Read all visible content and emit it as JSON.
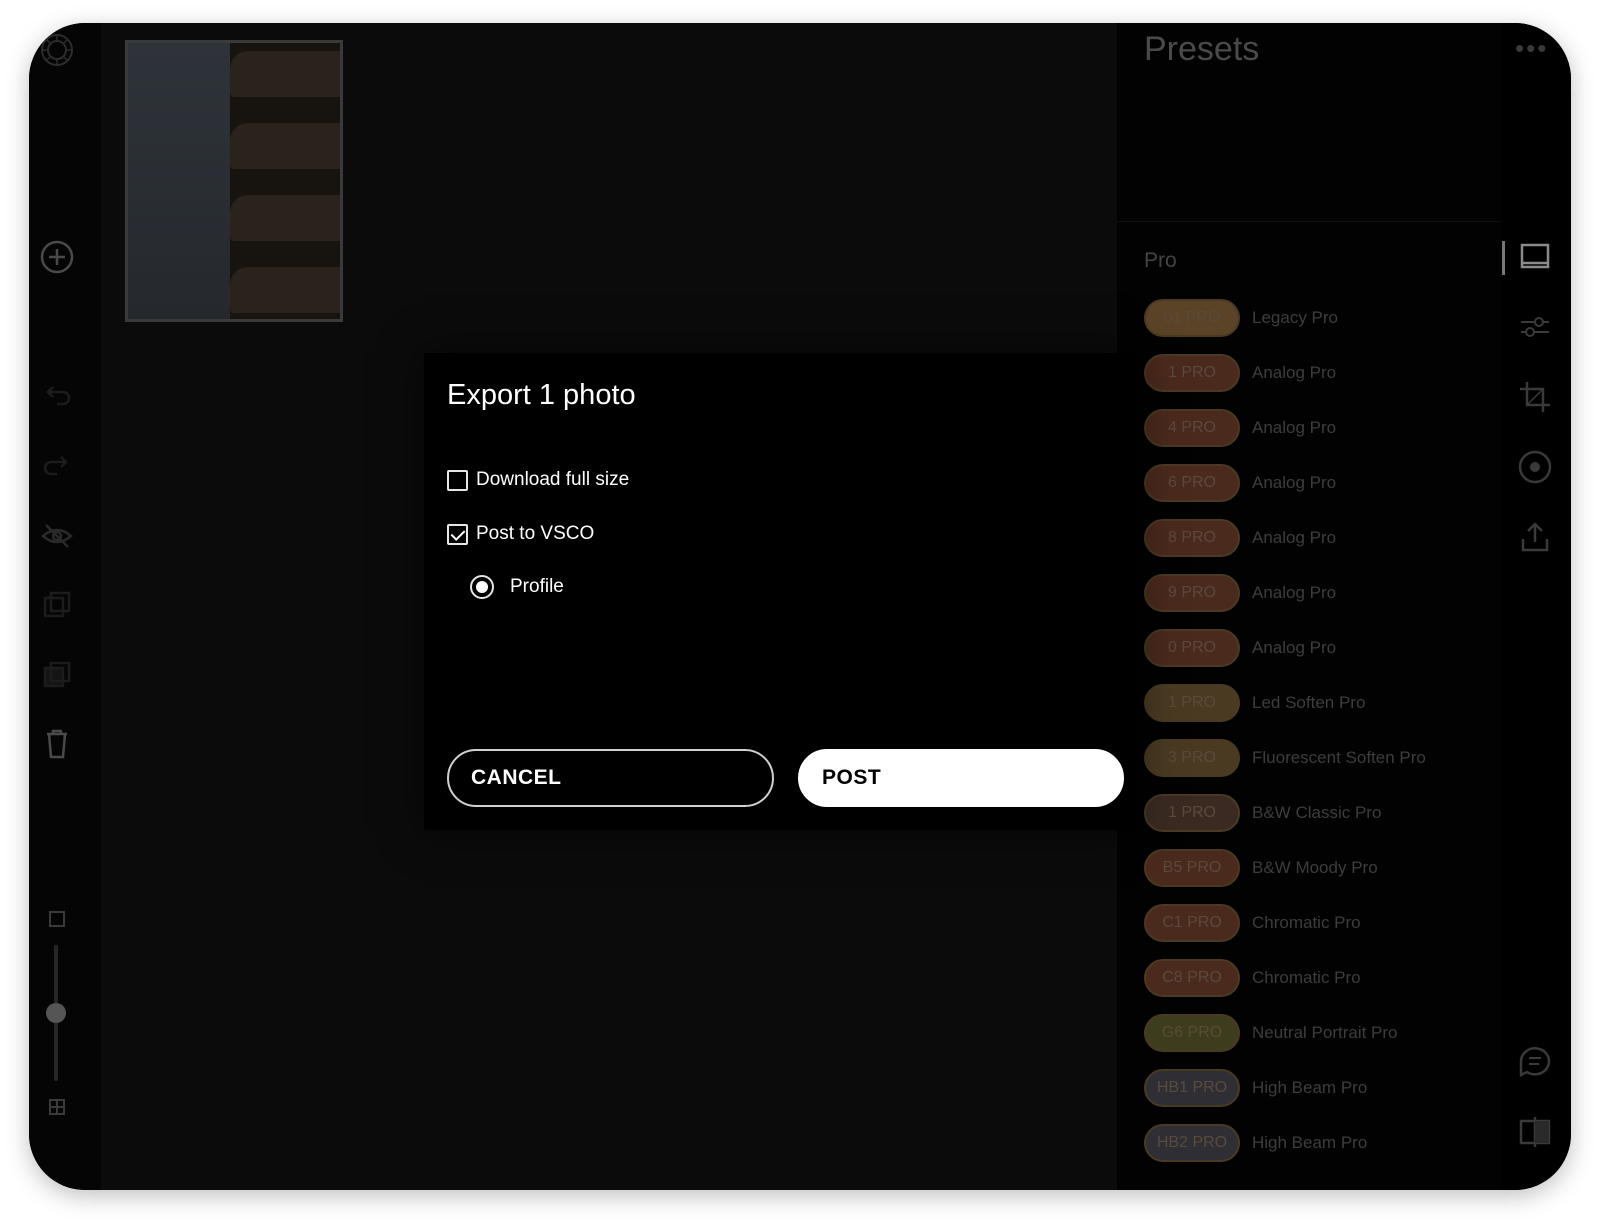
{
  "dialog": {
    "title": "Export 1 photo",
    "options": {
      "download_full_size": {
        "label": "Download full size",
        "checked": false
      },
      "post_to_vsco": {
        "label": "Post to VSCO",
        "checked": true
      }
    },
    "destination": {
      "label": "Profile",
      "selected": true
    },
    "cancel_label": "CANCEL",
    "post_label": "POST"
  },
  "presets": {
    "title": "Presets",
    "section": "Pro",
    "items": [
      {
        "code": "01 PRO",
        "name": "Legacy Pro",
        "color": "#5a4326"
      },
      {
        "code": "1 PRO",
        "name": "Analog Pro",
        "color": "#4a2a1c"
      },
      {
        "code": "4 PRO",
        "name": "Analog Pro",
        "color": "#4a2a1c"
      },
      {
        "code": "6 PRO",
        "name": "Analog Pro",
        "color": "#4a2a1c"
      },
      {
        "code": "8 PRO",
        "name": "Analog Pro",
        "color": "#4a2a1c"
      },
      {
        "code": "9 PRO",
        "name": "Analog Pro",
        "color": "#4a2a1c"
      },
      {
        "code": "0 PRO",
        "name": "Analog Pro",
        "color": "#4a2a1c"
      },
      {
        "code": "1 PRO",
        "name": "Led Soften Pro",
        "color": "#4a3a22"
      },
      {
        "code": "3 PRO",
        "name": "Fluorescent Soften Pro",
        "color": "#4a3a22"
      },
      {
        "code": "1 PRO",
        "name": "B&W Classic Pro",
        "color": "#3a2a22"
      },
      {
        "code": "B5 PRO",
        "name": "B&W Moody Pro",
        "color": "#4a2a1c"
      },
      {
        "code": "C1 PRO",
        "name": "Chromatic Pro",
        "color": "#4a2a1c"
      },
      {
        "code": "C8 PRO",
        "name": "Chromatic Pro",
        "color": "#4a2a1c"
      },
      {
        "code": "G6 PRO",
        "name": "Neutral Portrait Pro",
        "color": "#3d3c1c"
      },
      {
        "code": "HB1 PRO",
        "name": "High Beam Pro",
        "color": "#2e2e34"
      },
      {
        "code": "HB2 PRO",
        "name": "High Beam Pro",
        "color": "#2e2e34"
      }
    ]
  },
  "right_rail": {
    "more_label": "•••"
  },
  "icons": {
    "left_rail": [
      "logo-icon",
      "add-icon",
      "undo-icon",
      "redo-icon",
      "hide-icon",
      "copy-edits-icon",
      "paste-edits-icon",
      "delete-icon",
      "single-view-icon",
      "grid-view-icon"
    ],
    "right_rail": [
      "frame-icon",
      "adjust-icon",
      "crop-icon",
      "circle-icon",
      "export-icon",
      "chat-icon",
      "compare-icon"
    ]
  },
  "zoom_level": 0.5
}
